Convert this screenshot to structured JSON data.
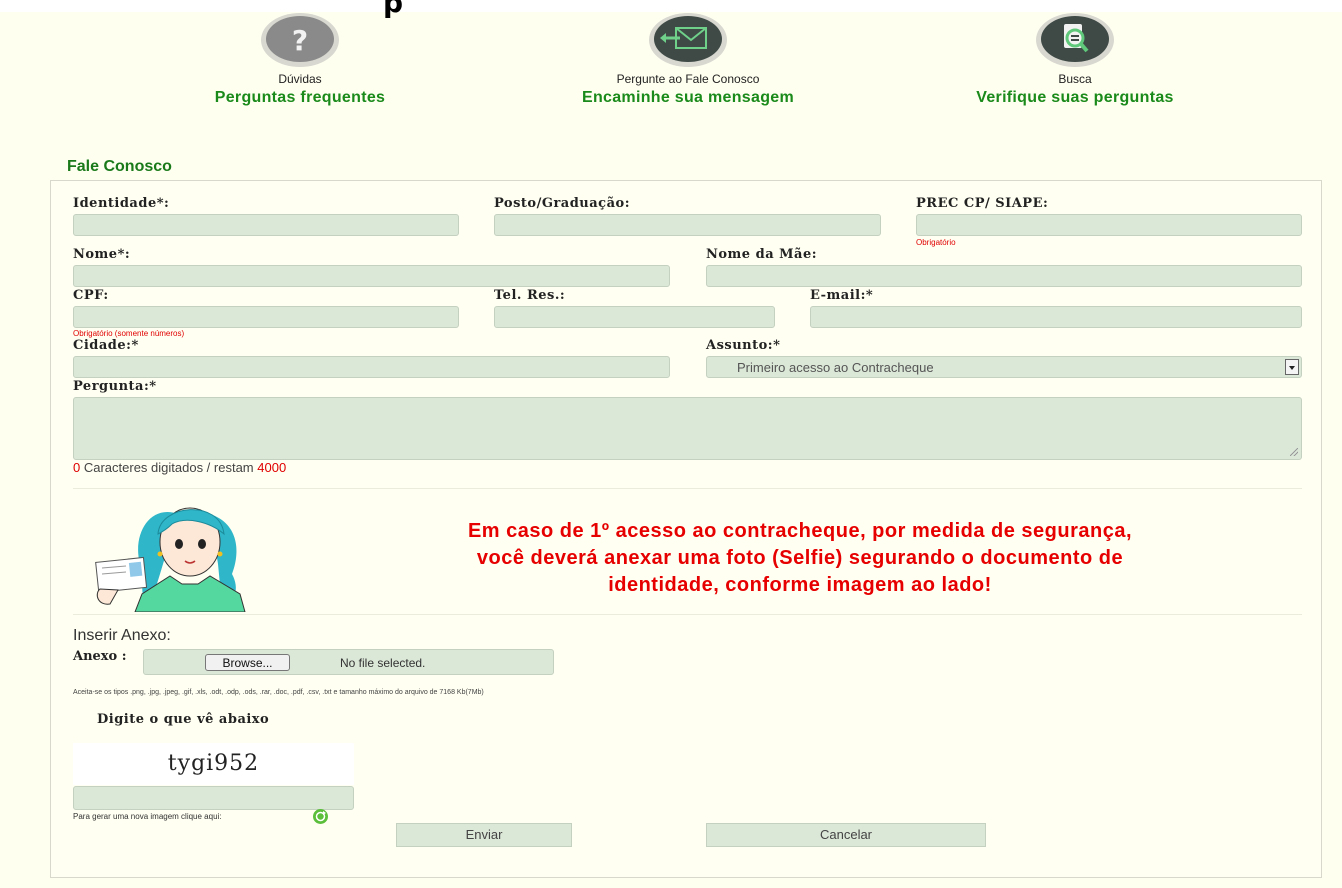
{
  "top_edge_glyph": "p",
  "cards": [
    {
      "title": "Dúvidas",
      "subtitle": "Perguntas frequentes",
      "icon": "question-icon"
    },
    {
      "title": "Pergunte ao Fale Conosco",
      "subtitle": "Encaminhe sua mensagem",
      "icon": "envelope-icon"
    },
    {
      "title": "Busca",
      "subtitle": "Verifique suas perguntas",
      "icon": "search-document-icon"
    }
  ],
  "section_title": "Fale Conosco",
  "form": {
    "identidade_label": "Identidade*:",
    "posto_label": "Posto/Graduação:",
    "prec_label": "PREC CP/ SIAPE:",
    "prec_hint": "Obrigatório",
    "nome_label": "Nome*:",
    "nome_mae_label": "Nome da Mãe:",
    "cpf_label": "CPF:",
    "cpf_hint": "Obrigatório (somente números)",
    "tel_label": "Tel. Res.:",
    "email_label": "E-mail:*",
    "cidade_label": "Cidade:*",
    "assunto_label": "Assunto:*",
    "assunto_value": "Primeiro acesso ao Contracheque",
    "pergunta_label": "Pergunta:*",
    "counter_typed": "0",
    "counter_middle": " Caracteres digitados / restam ",
    "counter_remaining": "4000"
  },
  "warning": {
    "line1": "Em caso de 1º acesso ao contracheque, por medida de segurança,",
    "line2": "você deverá anexar uma foto (Selfie) segurando o documento de",
    "line3": "identidade, conforme imagem ao lado!"
  },
  "attachment": {
    "title": "Inserir Anexo:",
    "label": "Anexo :",
    "browse_label": "Browse...",
    "status": "No file selected.",
    "accepted": "Aceita-se os tipos .png, .jpg, .jpeg, .gif, .xls, .odt, .odp, .ods, .rar, .doc, .pdf, .csv, .txt e tamanho máximo do arquivo de 7168 Kb(7Mb)"
  },
  "captcha": {
    "title": "Digite o que vê abaixo",
    "code": "tygi952",
    "refresh_text": "Para gerar uma nova imagem clique aqui:"
  },
  "buttons": {
    "submit": "Enviar",
    "cancel": "Cancelar"
  },
  "colors": {
    "accent_green": "#1a8a1a",
    "field_bg": "#dbe7d7",
    "warning_red": "#e60000",
    "page_bg": "#fffff0"
  }
}
